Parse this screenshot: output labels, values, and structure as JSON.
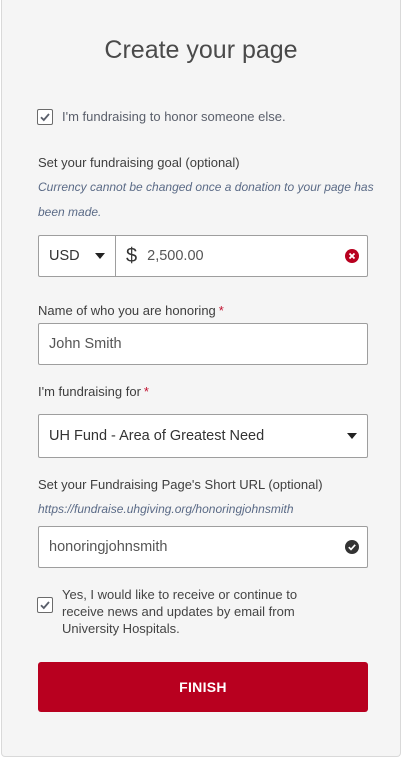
{
  "header": {
    "title": "Create your page"
  },
  "honor_checkbox": {
    "label": "I'm fundraising to honor someone else.",
    "checked": true
  },
  "goal": {
    "label": "Set your fundraising goal (optional)",
    "note": "Currency cannot be changed once a donation to your page has been made.",
    "currency": "USD",
    "currency_symbol": "$",
    "amount": "2,500.00"
  },
  "honoree": {
    "label": "Name of who you are honoring",
    "required": "*",
    "value": "John Smith"
  },
  "fund": {
    "label": "I'm fundraising for",
    "required": "*",
    "selected": "UH Fund - Area of Greatest Need"
  },
  "short_url": {
    "label": "Set your Fundraising Page's Short URL (optional)",
    "preview": "https://fundraise.uhgiving.org/honoringjohnsmith",
    "value": "honoringjohnsmith"
  },
  "newsletter": {
    "label": "Yes, I would like to receive or continue to receive news and updates by email from University Hospitals.",
    "checked": true
  },
  "actions": {
    "finish_label": "FINISH"
  },
  "colors": {
    "accent": "#b8001f",
    "required": "#c0102f",
    "note": "#5a6a86",
    "valid_icon": "#333333",
    "error_icon": "#b8001f"
  },
  "icons": {
    "checkbox_check": "check-icon",
    "currency_caret": "caret-down-icon",
    "amount_status": "error-x-icon",
    "fund_caret": "caret-down-icon",
    "url_status": "valid-check-icon"
  }
}
